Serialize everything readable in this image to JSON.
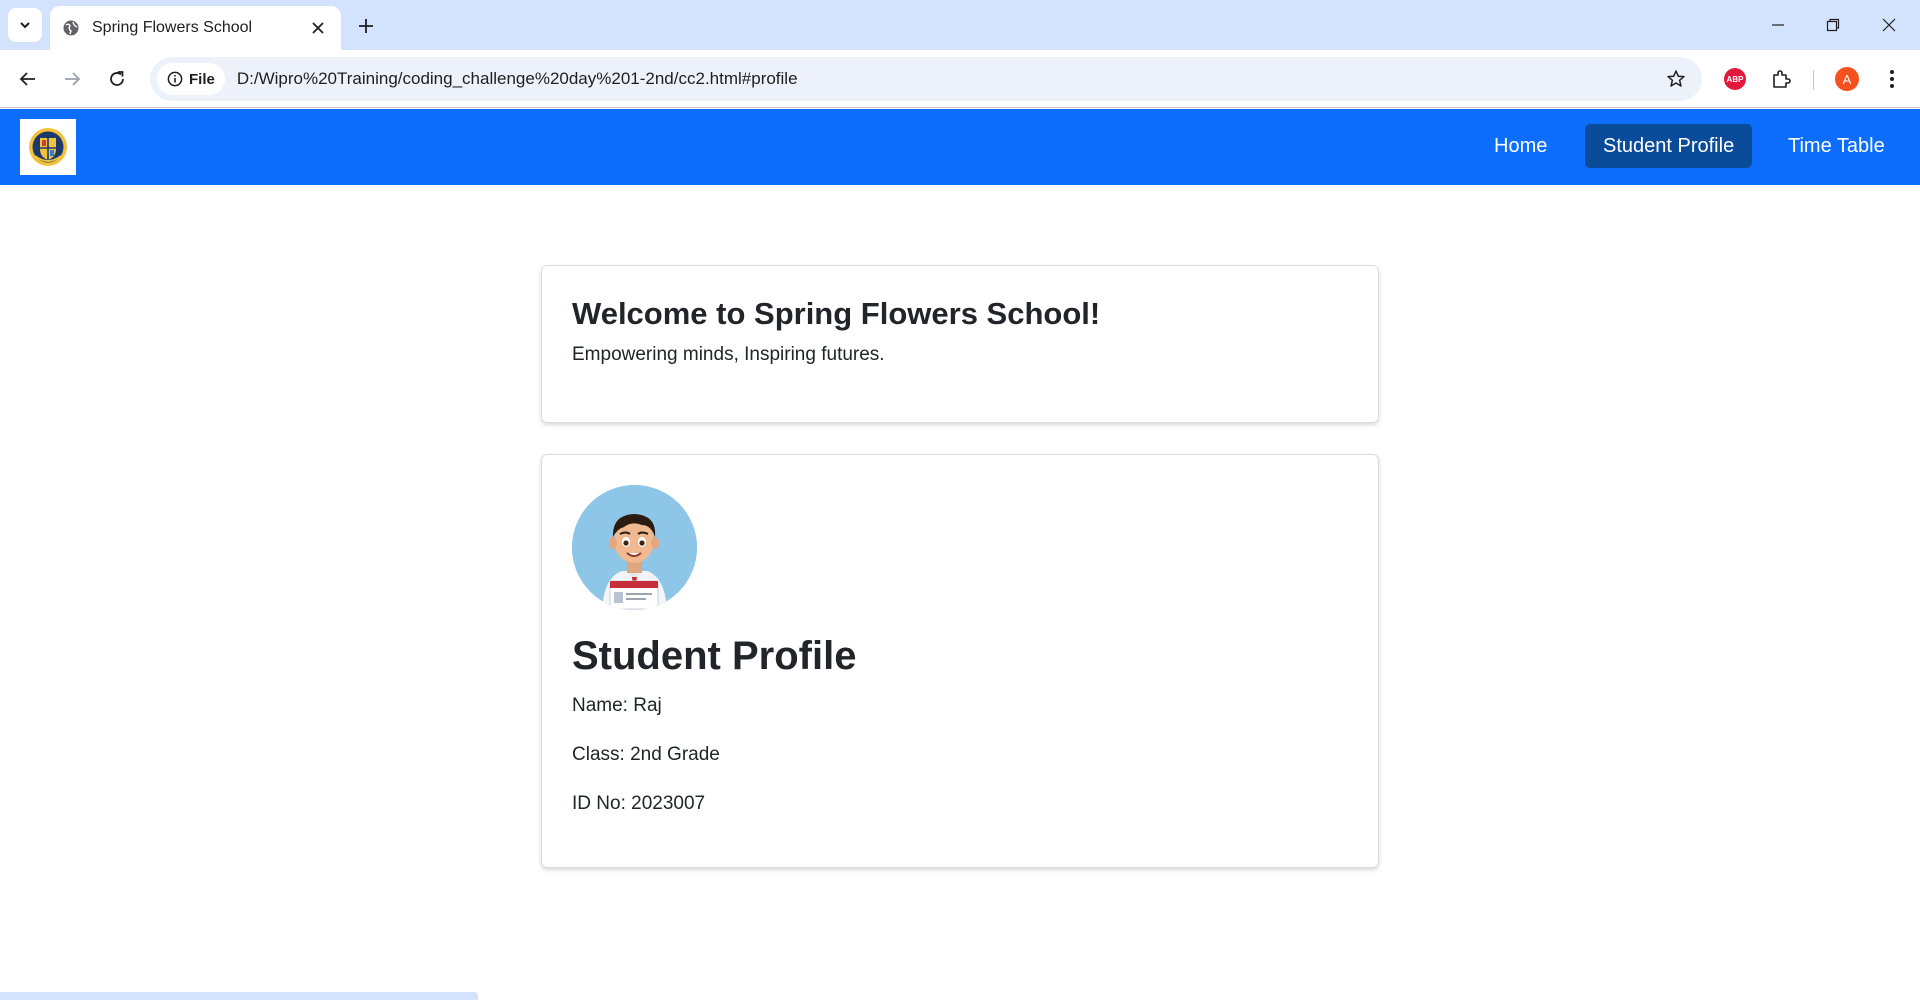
{
  "browser": {
    "tab_title": "Spring Flowers School",
    "site_chip_label": "File",
    "url": "D:/Wipro%20Training/coding_challenge%20day%201-2nd/cc2.html#profile",
    "profile_initial": "A",
    "adblock_label": "ABP"
  },
  "navbar": {
    "links": [
      {
        "label": "Home"
      },
      {
        "label": "Student Profile"
      },
      {
        "label": "Time Table"
      }
    ]
  },
  "welcome": {
    "heading": "Welcome to Spring Flowers School!",
    "tagline": "Empowering minds, Inspiring futures."
  },
  "profile": {
    "heading": "Student Profile",
    "name": "Name: Raj",
    "class": "Class: 2nd Grade",
    "id": "ID No: 2023007"
  }
}
